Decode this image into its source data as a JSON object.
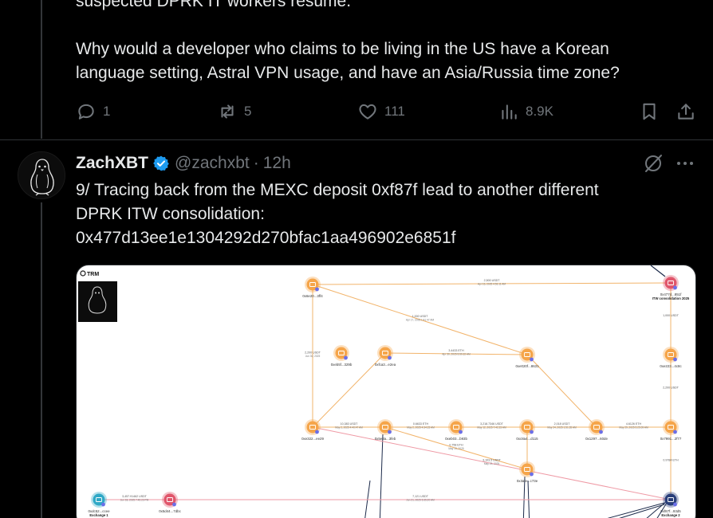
{
  "prev_tweet": {
    "partial_line": "suspected DPRK IT workers resume.",
    "paragraph_line1": "Why would a developer who claims to be living in the US have a Korean",
    "paragraph_line2": "language setting, Astral VPN usage, and have an Asia/Russia time zone?",
    "actions": {
      "replies": "1",
      "reposts": "5",
      "likes": "111",
      "views": "8.9K"
    }
  },
  "tweet": {
    "author_name": "ZachXBT",
    "handle": "@zachxbt",
    "separator": "·",
    "time": "12h",
    "text_line1": "9/ Tracing back from the MEXC deposit 0xf87f lead to another different",
    "text_line2": "DPRK ITW consolidation:",
    "text_line3": "0x477d13ee1e1304292d270bfac1aa496902e6851f"
  },
  "graph": {
    "brand": "TRM",
    "colors": {
      "orange": "#f5a54a",
      "red": "#e0566b",
      "teal": "#2fa8c6",
      "navy": "#2a3f7a",
      "edge": "#f2b46b",
      "edge_red": "#ef9aa5",
      "edge_dark": "#1c2a4a"
    },
    "nodes": [
      {
        "id": "n1",
        "label": "0x6e20...3ff4",
        "color": "orange"
      },
      {
        "id": "n2",
        "label": "0xeb5f...329b",
        "color": "orange"
      },
      {
        "id": "n3",
        "label": "0xfca3...e2ea",
        "color": "orange"
      },
      {
        "id": "n4",
        "label": "0xe020f...8631",
        "color": "orange"
      },
      {
        "id": "n5",
        "label": "0xe223...4c8c",
        "color": "orange"
      },
      {
        "id": "n6",
        "label": "0x477d...851f",
        "sub": "ITW consolidation 2025",
        "color": "red"
      },
      {
        "id": "n7",
        "label": "0xe322...ee29",
        "color": "orange"
      },
      {
        "id": "n8",
        "label": "0x5e3a...3feb",
        "color": "orange"
      },
      {
        "id": "n9",
        "label": "0xeb03...b93b",
        "color": "orange"
      },
      {
        "id": "n10",
        "label": "0xc8a4...d115",
        "color": "orange"
      },
      {
        "id": "n11",
        "label": "0x1297...60de",
        "color": "orange"
      },
      {
        "id": "n12",
        "label": "0x7991...2f77",
        "color": "orange"
      },
      {
        "id": "n13",
        "label": "0x3afe...c73e",
        "color": "orange"
      },
      {
        "id": "n14",
        "label": "0xdc52...ccee",
        "sub": "Exchange 1",
        "color": "teal"
      },
      {
        "id": "n15",
        "label": "0x5d44...7dbc",
        "color": "red"
      },
      {
        "id": "n16",
        "label": "0xf87f...93d5",
        "sub": "Exchange 2",
        "color": "navy"
      }
    ],
    "edges": [
      {
        "from": "n1",
        "to": "n6",
        "amt": "2,500 USDT",
        "date": "Apr 15, 2025 4:53:11 AM"
      },
      {
        "from": "n1",
        "to": "n7",
        "amt": "2,200 USDT",
        "date": "Jun 30, 2025"
      },
      {
        "from": "n1",
        "to": "n4",
        "amt": "1,000 USDT",
        "date": "Apr 17, 2025 1:41:47 AM"
      },
      {
        "from": "n3",
        "to": "n4",
        "amt": "3.4433 ETH",
        "date": "Apr 30, 2025 5:59:22 AM"
      },
      {
        "from": "n3",
        "to": "n7",
        "amt": "",
        "date": ""
      },
      {
        "from": "n7",
        "to": "n8",
        "amt": "10,383 USDT",
        "date": "May 2, 2025 4:40:47 AM"
      },
      {
        "from": "n8",
        "to": "n9",
        "amt": "0.6633 ETH",
        "date": "May 2, 2025 4:34:23 AM"
      },
      {
        "from": "n9",
        "to": "n10",
        "amt": "3,218.7346 USDT",
        "date": "May 12, 2025 7:42:23 AM"
      },
      {
        "from": "n10",
        "to": "n11",
        "amt": "2,018 USDT",
        "date": "May 24, 2025 1:51:35 AM"
      },
      {
        "from": "n11",
        "to": "n12",
        "amt": "4.6126 ETH",
        "date": "May 29, 2025 5:25:09 AM"
      },
      {
        "from": "n4",
        "to": "n11",
        "amt": "",
        "date": ""
      },
      {
        "from": "n5",
        "to": "n6",
        "amt": "1,000 USDT",
        "date": ""
      },
      {
        "from": "n12",
        "to": "n5",
        "amt": "2,200 USDT",
        "date": ""
      },
      {
        "from": "n12",
        "to": "n16",
        "amt": "0.9784 ETH",
        "date": ""
      },
      {
        "from": "n8",
        "to": "n13",
        "amt": "0.758 ETH",
        "date": "May 13, 2025"
      },
      {
        "from": "n13",
        "to": "n10",
        "amt": "",
        "date": ""
      },
      {
        "from": "n14",
        "to": "n15",
        "amt": "3,457.91462 USDT",
        "date": "Jun 18, 2025 7:45:23 PM"
      },
      {
        "from": "n15",
        "to": "n16",
        "amt": "7,121 USDT",
        "date": "Jun 21, 2025 5:35:20 AM"
      },
      {
        "from": "n7",
        "to": "n16",
        "amt": "3,103.5 USDT",
        "date": "May 23, 2025"
      }
    ]
  }
}
